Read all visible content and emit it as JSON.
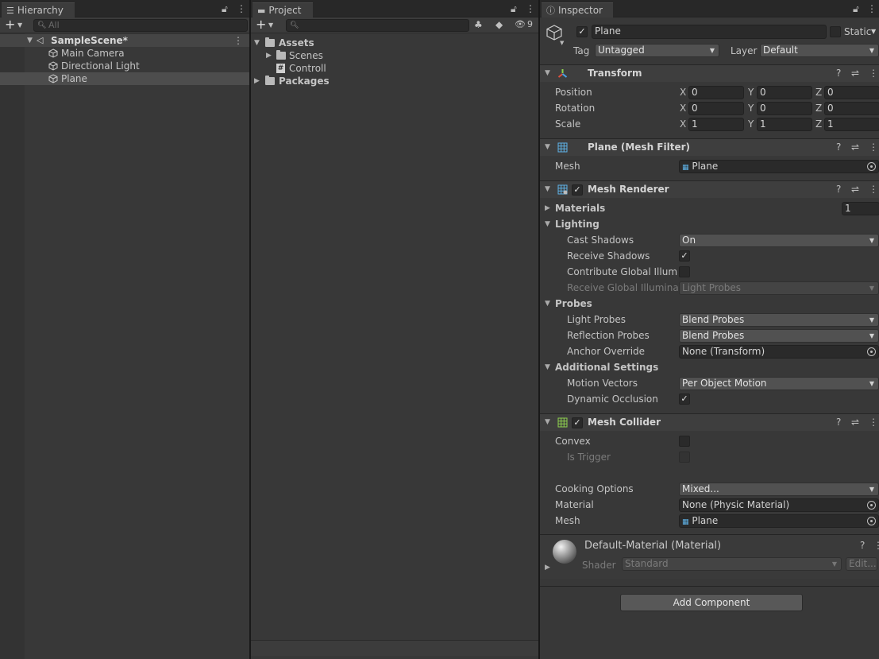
{
  "hierarchy": {
    "tab_label": "Hierarchy",
    "search_placeholder": "All",
    "scene": "SampleScene*",
    "items": [
      "Main Camera",
      "Directional Light",
      "Plane"
    ]
  },
  "project": {
    "tab_label": "Project",
    "hidden_count": "9",
    "assets_label": "Assets",
    "scenes_label": "Scenes",
    "script_label": "Controll",
    "packages_label": "Packages"
  },
  "inspector": {
    "tab_label": "Inspector",
    "object_name": "Plane",
    "static_label": "Static",
    "tag_label": "Tag",
    "tag_value": "Untagged",
    "layer_label": "Layer",
    "layer_value": "Default",
    "transform": {
      "title": "Transform",
      "position_label": "Position",
      "rotation_label": "Rotation",
      "scale_label": "Scale",
      "axes": [
        "X",
        "Y",
        "Z"
      ],
      "position": [
        "0",
        "0",
        "0"
      ],
      "rotation": [
        "0",
        "0",
        "0"
      ],
      "scale": [
        "1",
        "1",
        "1"
      ]
    },
    "mesh_filter": {
      "title": "Plane (Mesh Filter)",
      "mesh_label": "Mesh",
      "mesh_value": "Plane"
    },
    "mesh_renderer": {
      "title": "Mesh Renderer",
      "materials_label": "Materials",
      "materials_count": "1",
      "lighting_label": "Lighting",
      "cast_shadows_label": "Cast Shadows",
      "cast_shadows_value": "On",
      "receive_shadows_label": "Receive Shadows",
      "contribute_gi_label": "Contribute Global Illumina",
      "receive_gi_label": "Receive Global Illuminati",
      "receive_gi_value": "Light Probes",
      "probes_label": "Probes",
      "light_probes_label": "Light Probes",
      "light_probes_value": "Blend Probes",
      "reflection_probes_label": "Reflection Probes",
      "reflection_probes_value": "Blend Probes",
      "anchor_override_label": "Anchor Override",
      "anchor_override_value": "None (Transform)",
      "additional_label": "Additional Settings",
      "motion_vectors_label": "Motion Vectors",
      "motion_vectors_value": "Per Object Motion",
      "dynamic_occlusion_label": "Dynamic Occlusion"
    },
    "mesh_collider": {
      "title": "Mesh Collider",
      "convex_label": "Convex",
      "is_trigger_label": "Is Trigger",
      "cooking_label": "Cooking Options",
      "cooking_value": "Mixed...",
      "material_label": "Material",
      "material_value": "None (Physic Material)",
      "mesh_label": "Mesh",
      "mesh_value": "Plane"
    },
    "material": {
      "title": "Default-Material (Material)",
      "shader_label": "Shader",
      "shader_value": "Standard",
      "edit_label": "Edit..."
    },
    "add_component_label": "Add Component"
  },
  "colors": {
    "panel_bg": "#383838",
    "header_bg": "#3e3e3e",
    "field_bg": "#2a2a2a",
    "selection": "#4d4d4d"
  }
}
